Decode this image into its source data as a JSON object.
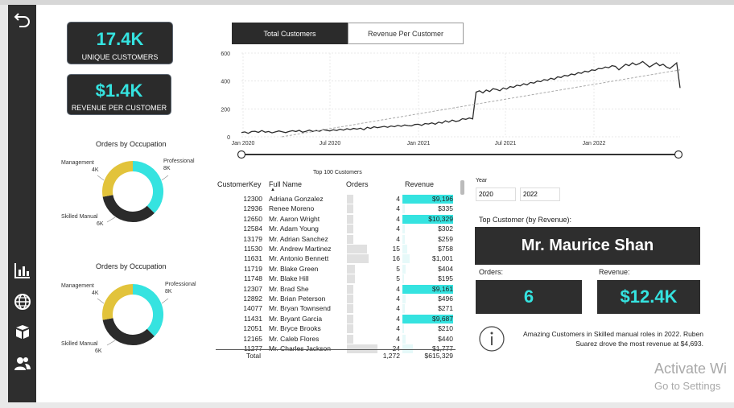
{
  "colors": {
    "sidebar": "#2e2e2e",
    "accent": "#35e3e0",
    "gold": "#e2c33b",
    "dark": "#2b2b2b"
  },
  "sidebar": {
    "icons": [
      "back-arrow-icon",
      "bar-chart-icon",
      "globe-icon",
      "boxes-icon",
      "users-icon"
    ]
  },
  "kpis": [
    {
      "value": "17.4K",
      "label": "UNIQUE CUSTOMERS"
    },
    {
      "value": "$1.4K",
      "label": "REVENUE PER CUSTOMER"
    }
  ],
  "donuts": [
    {
      "title": "Orders by Occupation",
      "labels": {
        "management": "Management",
        "management_val": "4K",
        "professional": "Professional",
        "professional_val": "8K",
        "skilled": "Skilled Manual",
        "skilled_val": "6K"
      }
    },
    {
      "title": "Orders by Occupation",
      "labels": {
        "management": "Management",
        "management_val": "4K",
        "professional": "Professional",
        "professional_val": "8K",
        "skilled": "Skilled Manual",
        "skilled_val": "6K"
      }
    }
  ],
  "tabs": {
    "active": "Total Customers",
    "inactive": "Revenue Per Customer"
  },
  "chart_data": {
    "type": "line",
    "yticks": [
      "0",
      "200",
      "400",
      "600"
    ],
    "xticks": [
      "Jan 2020",
      "Jul 2020",
      "Jan 2021",
      "Jul 2021",
      "Jan 2022"
    ],
    "ylim": [
      0,
      600
    ],
    "series": [
      {
        "values": [
          30,
          35,
          25,
          38,
          40,
          32,
          45,
          33,
          38,
          28,
          35,
          42,
          36,
          30,
          38,
          44,
          38,
          46,
          33,
          40,
          48,
          38,
          45,
          40,
          52,
          46,
          42,
          50,
          45,
          55,
          48,
          58,
          52,
          60,
          55,
          62,
          50,
          68,
          60,
          72,
          65,
          70,
          75,
          68,
          78,
          72,
          82,
          75,
          85,
          80,
          78,
          88,
          90,
          82,
          95,
          92,
          100,
          90,
          105,
          98,
          115,
          105,
          120,
          110,
          115,
          130,
          125,
          135,
          128,
          320,
          330,
          315,
          335,
          325,
          345,
          340,
          330,
          350,
          342,
          360,
          355,
          370,
          365,
          380,
          372,
          390,
          385,
          400,
          395,
          410,
          405,
          420,
          412,
          430,
          425,
          440,
          436,
          450,
          445,
          460,
          455,
          470,
          465,
          480,
          476,
          490,
          488,
          500,
          495,
          510,
          505,
          480,
          500,
          520,
          510,
          530,
          515,
          525,
          540,
          520,
          500,
          515,
          530,
          510,
          520,
          500,
          490,
          510,
          530,
          350
        ]
      }
    ],
    "trend": [
      0,
      480
    ],
    "grid": true
  },
  "table": {
    "title": "Top 100 Customers",
    "columns": [
      "CustomerKey",
      "Full Name",
      "Orders",
      "Revenue"
    ],
    "rows": [
      {
        "key": "12300",
        "name": "Adriana Gonzalez",
        "orders": "4",
        "revenue": "$9,196",
        "rev_frac": 1.0,
        "ord_frac": 0.2
      },
      {
        "key": "12936",
        "name": "Renee Moreno",
        "orders": "4",
        "revenue": "$335",
        "rev_frac": 0.05,
        "ord_frac": 0.2
      },
      {
        "key": "12650",
        "name": "Mr. Aaron Wright",
        "orders": "4",
        "revenue": "$10,329",
        "rev_frac": 1.0,
        "ord_frac": 0.2
      },
      {
        "key": "12584",
        "name": "Mr. Adam Young",
        "orders": "4",
        "revenue": "$302",
        "rev_frac": 0.05,
        "ord_frac": 0.2
      },
      {
        "key": "13179",
        "name": "Mr. Adrian Sanchez",
        "orders": "4",
        "revenue": "$259",
        "rev_frac": 0.04,
        "ord_frac": 0.2
      },
      {
        "key": "11530",
        "name": "Mr. Andrew Martinez",
        "orders": "15",
        "revenue": "$758",
        "rev_frac": 0.1,
        "ord_frac": 0.65
      },
      {
        "key": "11631",
        "name": "Mr. Antonio Bennett",
        "orders": "16",
        "revenue": "$1,001",
        "rev_frac": 0.14,
        "ord_frac": 0.7
      },
      {
        "key": "11719",
        "name": "Mr. Blake Green",
        "orders": "5",
        "revenue": "$404",
        "rev_frac": 0.06,
        "ord_frac": 0.25
      },
      {
        "key": "11748",
        "name": "Mr. Blake Hill",
        "orders": "5",
        "revenue": "$195",
        "rev_frac": 0.03,
        "ord_frac": 0.25
      },
      {
        "key": "12307",
        "name": "Mr. Brad She",
        "orders": "4",
        "revenue": "$9,161",
        "rev_frac": 1.0,
        "ord_frac": 0.2
      },
      {
        "key": "12892",
        "name": "Mr. Brian Peterson",
        "orders": "4",
        "revenue": "$496",
        "rev_frac": 0.07,
        "ord_frac": 0.2
      },
      {
        "key": "14077",
        "name": "Mr. Bryan Townsend",
        "orders": "4",
        "revenue": "$271",
        "rev_frac": 0.04,
        "ord_frac": 0.2
      },
      {
        "key": "11431",
        "name": "Mr. Bryant Garcia",
        "orders": "4",
        "revenue": "$9,687",
        "rev_frac": 1.0,
        "ord_frac": 0.2
      },
      {
        "key": "12051",
        "name": "Mr. Bryce Brooks",
        "orders": "4",
        "revenue": "$210",
        "rev_frac": 0.03,
        "ord_frac": 0.2
      },
      {
        "key": "12165",
        "name": "Mr. Caleb Flores",
        "orders": "4",
        "revenue": "$440",
        "rev_frac": 0.06,
        "ord_frac": 0.2
      },
      {
        "key": "11277",
        "name": "Mr. Charles Jackson",
        "orders": "24",
        "revenue": "$1,777",
        "rev_frac": 0.2,
        "ord_frac": 1.0
      }
    ],
    "total_label": "Total",
    "total_orders": "1,272",
    "total_revenue": "$615,329"
  },
  "year": {
    "label": "Year",
    "from": "2020",
    "to": "2022"
  },
  "top_customer": {
    "label": "Top Customer (by Revenue):",
    "name": "Mr. Maurice Shan",
    "orders_label": "Orders:",
    "orders": "6",
    "revenue_label": "Revenue:",
    "revenue": "$12.4K"
  },
  "insight": "Amazing Customers in Skilled manual roles in 2022. Ruben Suarez drove the most revenue at $4,693.",
  "watermark": {
    "line1": "Activate Wi",
    "line2": "Go to Settings"
  }
}
